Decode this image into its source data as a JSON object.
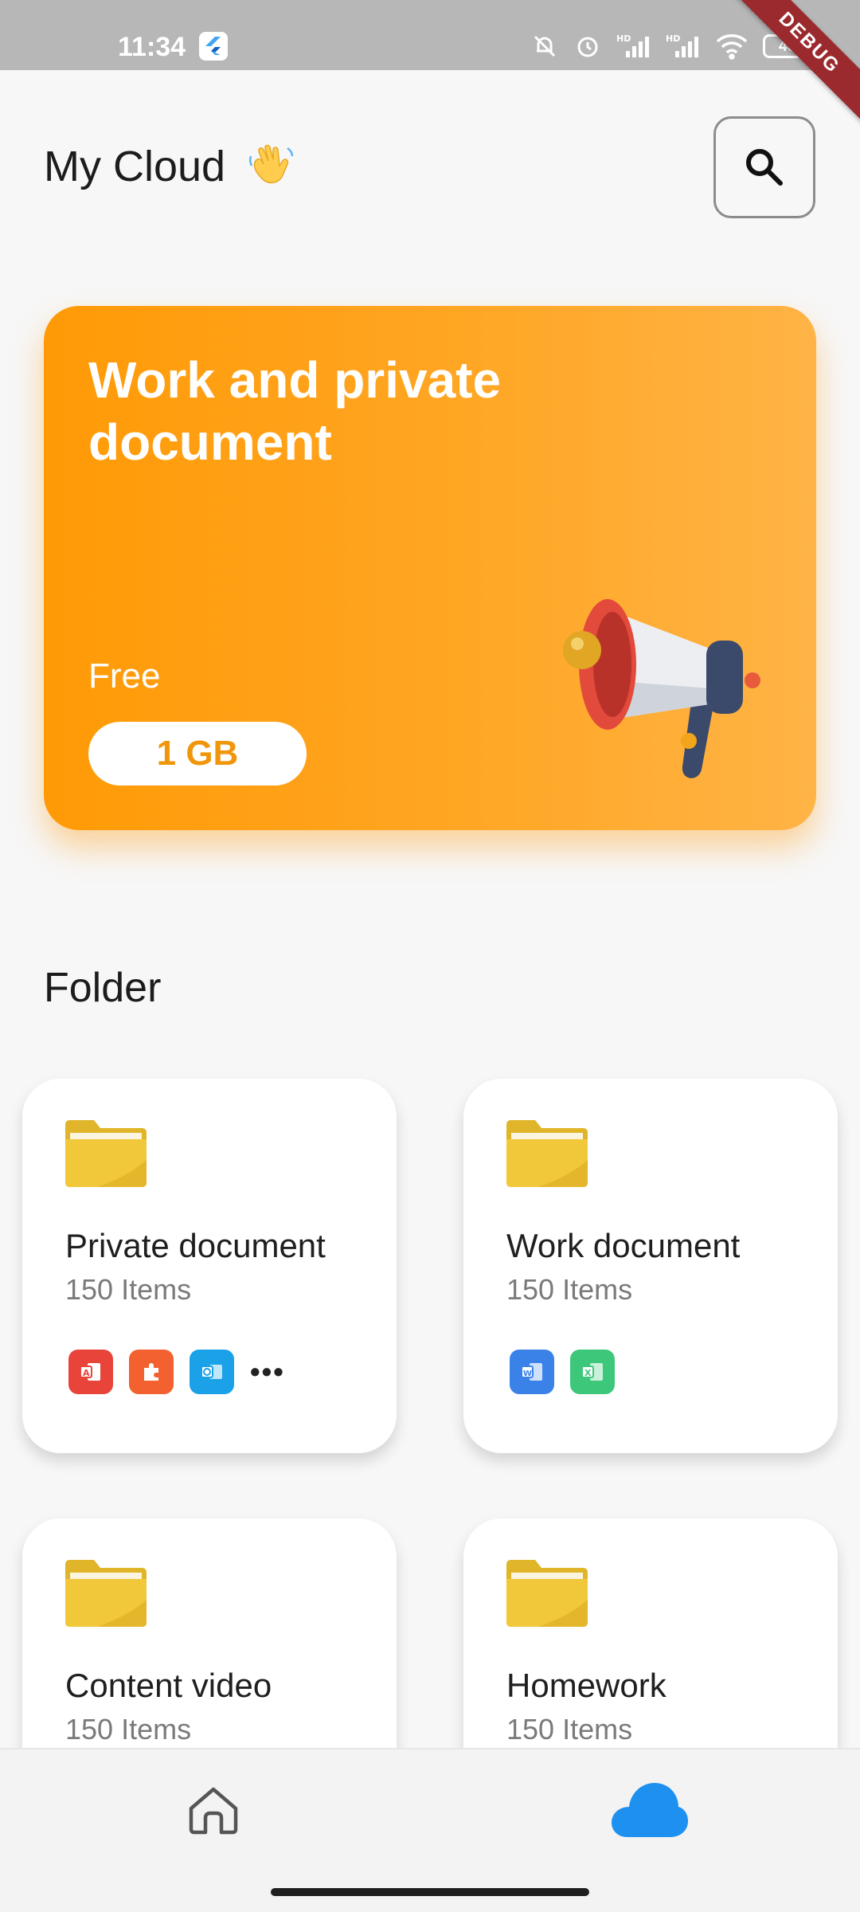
{
  "status_bar": {
    "time": "11:34",
    "battery": "45",
    "debug": "DEBUG",
    "icons": [
      "flutter-icon",
      "mute-icon",
      "alarm-icon",
      "hd-signal-icon",
      "hd-signal-icon",
      "wifi-icon",
      "battery-icon"
    ]
  },
  "header": {
    "title": "My Cloud",
    "emoji_icon": "waving-hand-icon",
    "search_icon": "search-icon"
  },
  "promo": {
    "title": "Work and private document",
    "free_label": "Free",
    "free_amount": "1 GB",
    "illustration": "megaphone-icon"
  },
  "folders": {
    "section_title": "Folder",
    "items": [
      {
        "name": "Private document",
        "count": "150 Items",
        "apps": [
          "acrobat-icon",
          "puzzle-icon",
          "outlook-icon"
        ],
        "more": "•••"
      },
      {
        "name": "Work document",
        "count": "150 Items",
        "apps": [
          "word-icon",
          "excel-icon"
        ]
      },
      {
        "name": "Content video",
        "count": "150 Items"
      },
      {
        "name": "Homework",
        "count": "150 Items"
      }
    ]
  },
  "bottom_nav": {
    "items": [
      "home-icon",
      "cloud-icon"
    ],
    "active": "cloud-icon",
    "accent": "#1e90f0"
  },
  "colors": {
    "accent_orange": "#ff9a06",
    "folder_yellow": "#f0c83a",
    "cloud_blue": "#1e90f0"
  }
}
